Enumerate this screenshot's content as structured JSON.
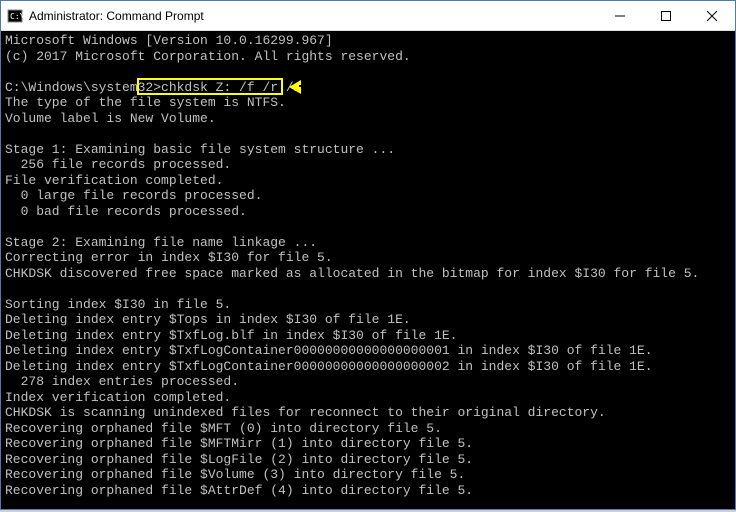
{
  "window": {
    "title": "Administrator: Command Prompt"
  },
  "terminal": {
    "line1": "Microsoft Windows [Version 10.0.16299.967]",
    "line2": "(c) 2017 Microsoft Corporation. All rights reserved.",
    "blank1": "",
    "prompt": "C:\\Windows\\system32>",
    "command": "chkdsk Z: /f /r /x",
    "line4": "The type of the file system is NTFS.",
    "line5": "Volume label is New Volume.",
    "blank2": "",
    "line6": "Stage 1: Examining basic file system structure ...",
    "line7": "  256 file records processed.",
    "line8": "File verification completed.",
    "line9": "  0 large file records processed.",
    "line10": "  0 bad file records processed.",
    "blank3": "",
    "line11": "Stage 2: Examining file name linkage ...",
    "line12": "Correcting error in index $I30 for file 5.",
    "line13": "CHKDSK discovered free space marked as allocated in the bitmap for index $I30 for file 5.",
    "blank4": "",
    "line14": "Sorting index $I30 in file 5.",
    "line15": "Deleting index entry $Tops in index $I30 of file 1E.",
    "line16": "Deleting index entry $TxfLog.blf in index $I30 of file 1E.",
    "line17": "Deleting index entry $TxfLogContainer00000000000000000001 in index $I30 of file 1E.",
    "line18": "Deleting index entry $TxfLogContainer00000000000000000002 in index $I30 of file 1E.",
    "line19": "  278 index entries processed.",
    "line20": "Index verification completed.",
    "line21": "CHKDSK is scanning unindexed files for reconnect to their original directory.",
    "line22": "Recovering orphaned file $MFT (0) into directory file 5.",
    "line23": "Recovering orphaned file $MFTMirr (1) into directory file 5.",
    "line24": "Recovering orphaned file $LogFile (2) into directory file 5.",
    "line25": "Recovering orphaned file $Volume (3) into directory file 5.",
    "line26": "Recovering orphaned file $AttrDef (4) into directory file 5."
  }
}
